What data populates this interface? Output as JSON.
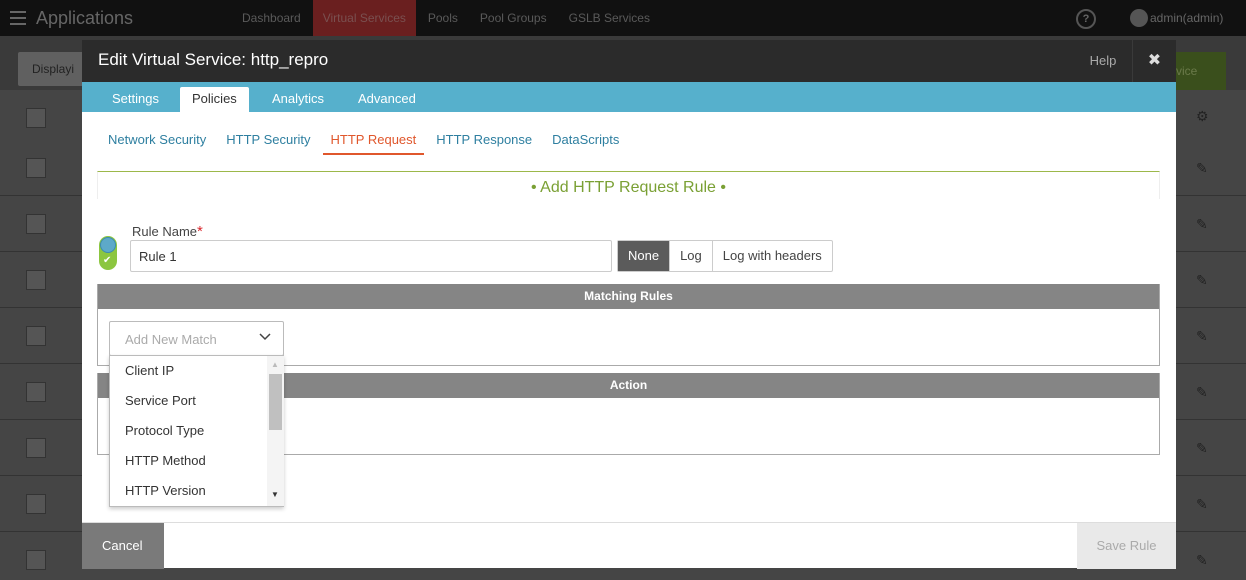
{
  "app": {
    "title": "Applications",
    "nav_tabs": [
      "Dashboard",
      "Virtual Services",
      "Pools",
      "Pool Groups",
      "GSLB Services"
    ],
    "user": "admin(admin)",
    "help_glyph": "?",
    "display_label": "Displayi",
    "create_label": "vice"
  },
  "modal": {
    "title": "Edit Virtual Service: http_repro",
    "help_label": "Help",
    "close_glyph": "✖",
    "tabs": [
      "Settings",
      "Policies",
      "Analytics",
      "Advanced"
    ],
    "active_tab": "Policies",
    "subtabs": [
      "Network Security",
      "HTTP Security",
      "HTTP Request",
      "HTTP Response",
      "DataScripts"
    ],
    "active_subtab": "HTTP Request",
    "rule_header": "• Add HTTP Request Rule •",
    "rule_name_label": "Rule Name",
    "required_mark": "*",
    "rule_name_value": "Rule 1",
    "log_options": [
      "None",
      "Log",
      "Log with headers"
    ],
    "log_selected": "None",
    "matching_rules_label": "Matching Rules",
    "action_label": "Action",
    "add_match_placeholder": "Add New Match",
    "match_options": [
      "Client IP",
      "Service Port",
      "Protocol Type",
      "HTTP Method",
      "HTTP Version"
    ],
    "cancel_label": "Cancel",
    "save_label": "Save Rule"
  },
  "colors": {
    "tabbar": "#56b0cc",
    "active_subtab": "#e0572c",
    "rule_header": "#7aa034",
    "section_bar": "#858585"
  },
  "icons": {
    "menu": "hamburger-icon",
    "help": "help-circle-icon",
    "user": "user-icon",
    "close": "close-icon",
    "settings": "gear-icon",
    "edit": "pencil-icon",
    "toggle": "enable-toggle-icon"
  }
}
